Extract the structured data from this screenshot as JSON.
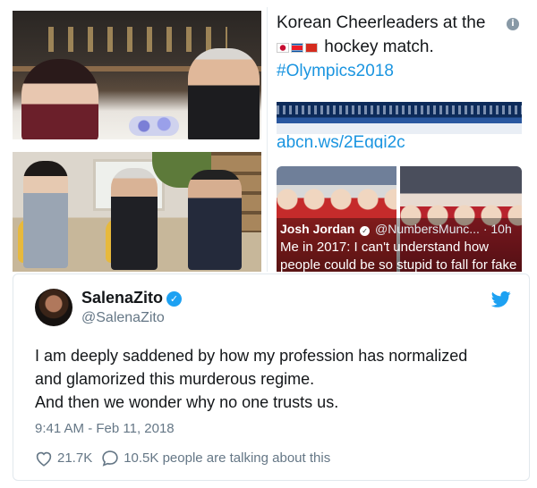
{
  "collage": {
    "hockey_tile": {
      "text_line1": "Korean Cheerleaders at the",
      "text_line2": "hockey match.",
      "hashtag": "#Olympics2018",
      "flags": [
        "flag-south-korea-icon",
        "flag-north-korea-icon",
        "flag-switzerland-icon"
      ]
    },
    "reply_tile": {
      "link_text": "abcn.ws/2Egqi2c",
      "author_name": "Josh Jordan",
      "author_handle": "@NumbersMunc...",
      "time": "· 10h",
      "text_line1": "Me in 2017: I can't understand how",
      "text_line2": "people could be so stupid to fall for fake"
    }
  },
  "tweet": {
    "display_name": "SalenaZito",
    "handle": "@SalenaZito",
    "body_line1": "I am deeply saddened by how my profession has normalized",
    "body_line2": "and glamorized this murderous regime.",
    "body_line3": "And then we wonder why no one trusts us.",
    "timestamp": "9:41 AM - Feb 11, 2018",
    "likes": "21.7K",
    "comments": "10.5K people are talking about this",
    "verified": true
  },
  "colors": {
    "twitter_blue": "#1da1f2",
    "link_blue": "#1b95e0",
    "text_primary": "#14171a",
    "text_secondary": "#657786",
    "border": "#e1e8ed"
  }
}
